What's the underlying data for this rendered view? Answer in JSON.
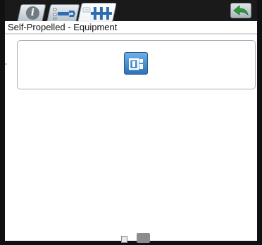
{
  "header": {
    "tabs": [
      {
        "id": "info",
        "icon": "info-icon",
        "active": false
      },
      {
        "id": "diagnostics",
        "icon": "wrench-icon",
        "active": false
      },
      {
        "id": "equipment",
        "icon": "equipment-config-icon",
        "active": true
      }
    ],
    "back_icon": "back-arrow-icon"
  },
  "page": {
    "title": "Self-Propelled - Equipment"
  },
  "card": {
    "button_icon": "equipment-settings-icon"
  },
  "pager": {
    "pages": 2,
    "current": 2
  },
  "colors": {
    "accent_blue": "#2b72b8",
    "back_green": "#2e9a3c",
    "frame": "#111111"
  }
}
